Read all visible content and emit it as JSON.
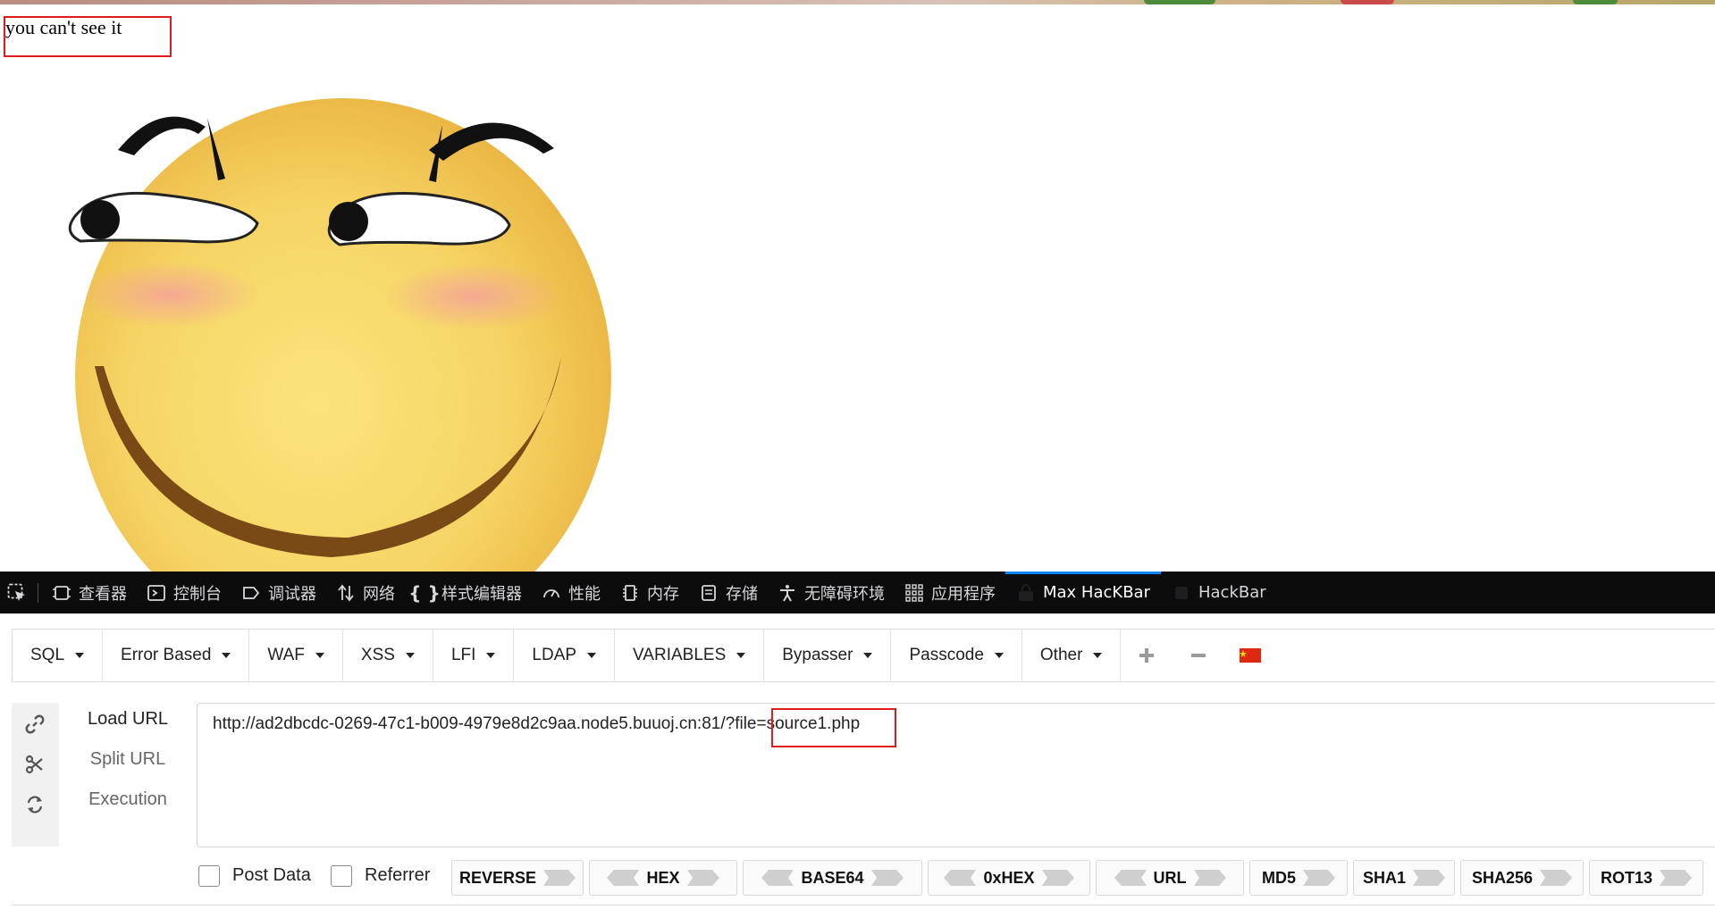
{
  "page": {
    "text": "you can't see it"
  },
  "devtools": {
    "tabs": [
      {
        "label": "查看器",
        "icon": "inspector-icon"
      },
      {
        "label": "控制台",
        "icon": "console-icon"
      },
      {
        "label": "调试器",
        "icon": "debugger-icon"
      },
      {
        "label": "网络",
        "icon": "network-icon"
      },
      {
        "label": "样式编辑器",
        "icon": "style-editor-icon"
      },
      {
        "label": "性能",
        "icon": "performance-icon"
      },
      {
        "label": "内存",
        "icon": "memory-icon"
      },
      {
        "label": "存储",
        "icon": "storage-icon"
      },
      {
        "label": "无障碍环境",
        "icon": "accessibility-icon"
      },
      {
        "label": "应用程序",
        "icon": "application-icon"
      },
      {
        "label": "Max HacKBar",
        "icon": "max-hackbar-icon",
        "active": true
      },
      {
        "label": "HackBar",
        "icon": "hackbar-icon"
      }
    ]
  },
  "hackbar": {
    "menus": [
      "SQL",
      "Error Based",
      "WAF",
      "XSS",
      "LFI",
      "LDAP",
      "VARIABLES",
      "Bypasser",
      "Passcode",
      "Other"
    ],
    "actions": {
      "load": "Load URL",
      "split": "Split URL",
      "execute": "Execution"
    },
    "url": "http://ad2dbcdc-0269-47c1-b009-4979e8d2c9aa.node5.buuoj.cn:81/?file=source1.php",
    "checkboxes": {
      "post": "Post Data",
      "referrer": "Referrer"
    },
    "encoders": [
      "REVERSE",
      "HEX",
      "BASE64",
      "0xHEX",
      "URL",
      "MD5",
      "SHA1",
      "SHA256",
      "ROT13"
    ],
    "colors": {
      "highlight": "#e01b1b",
      "devtools_bg": "#0c0c0d",
      "active_tab": "#0a84ff"
    }
  }
}
